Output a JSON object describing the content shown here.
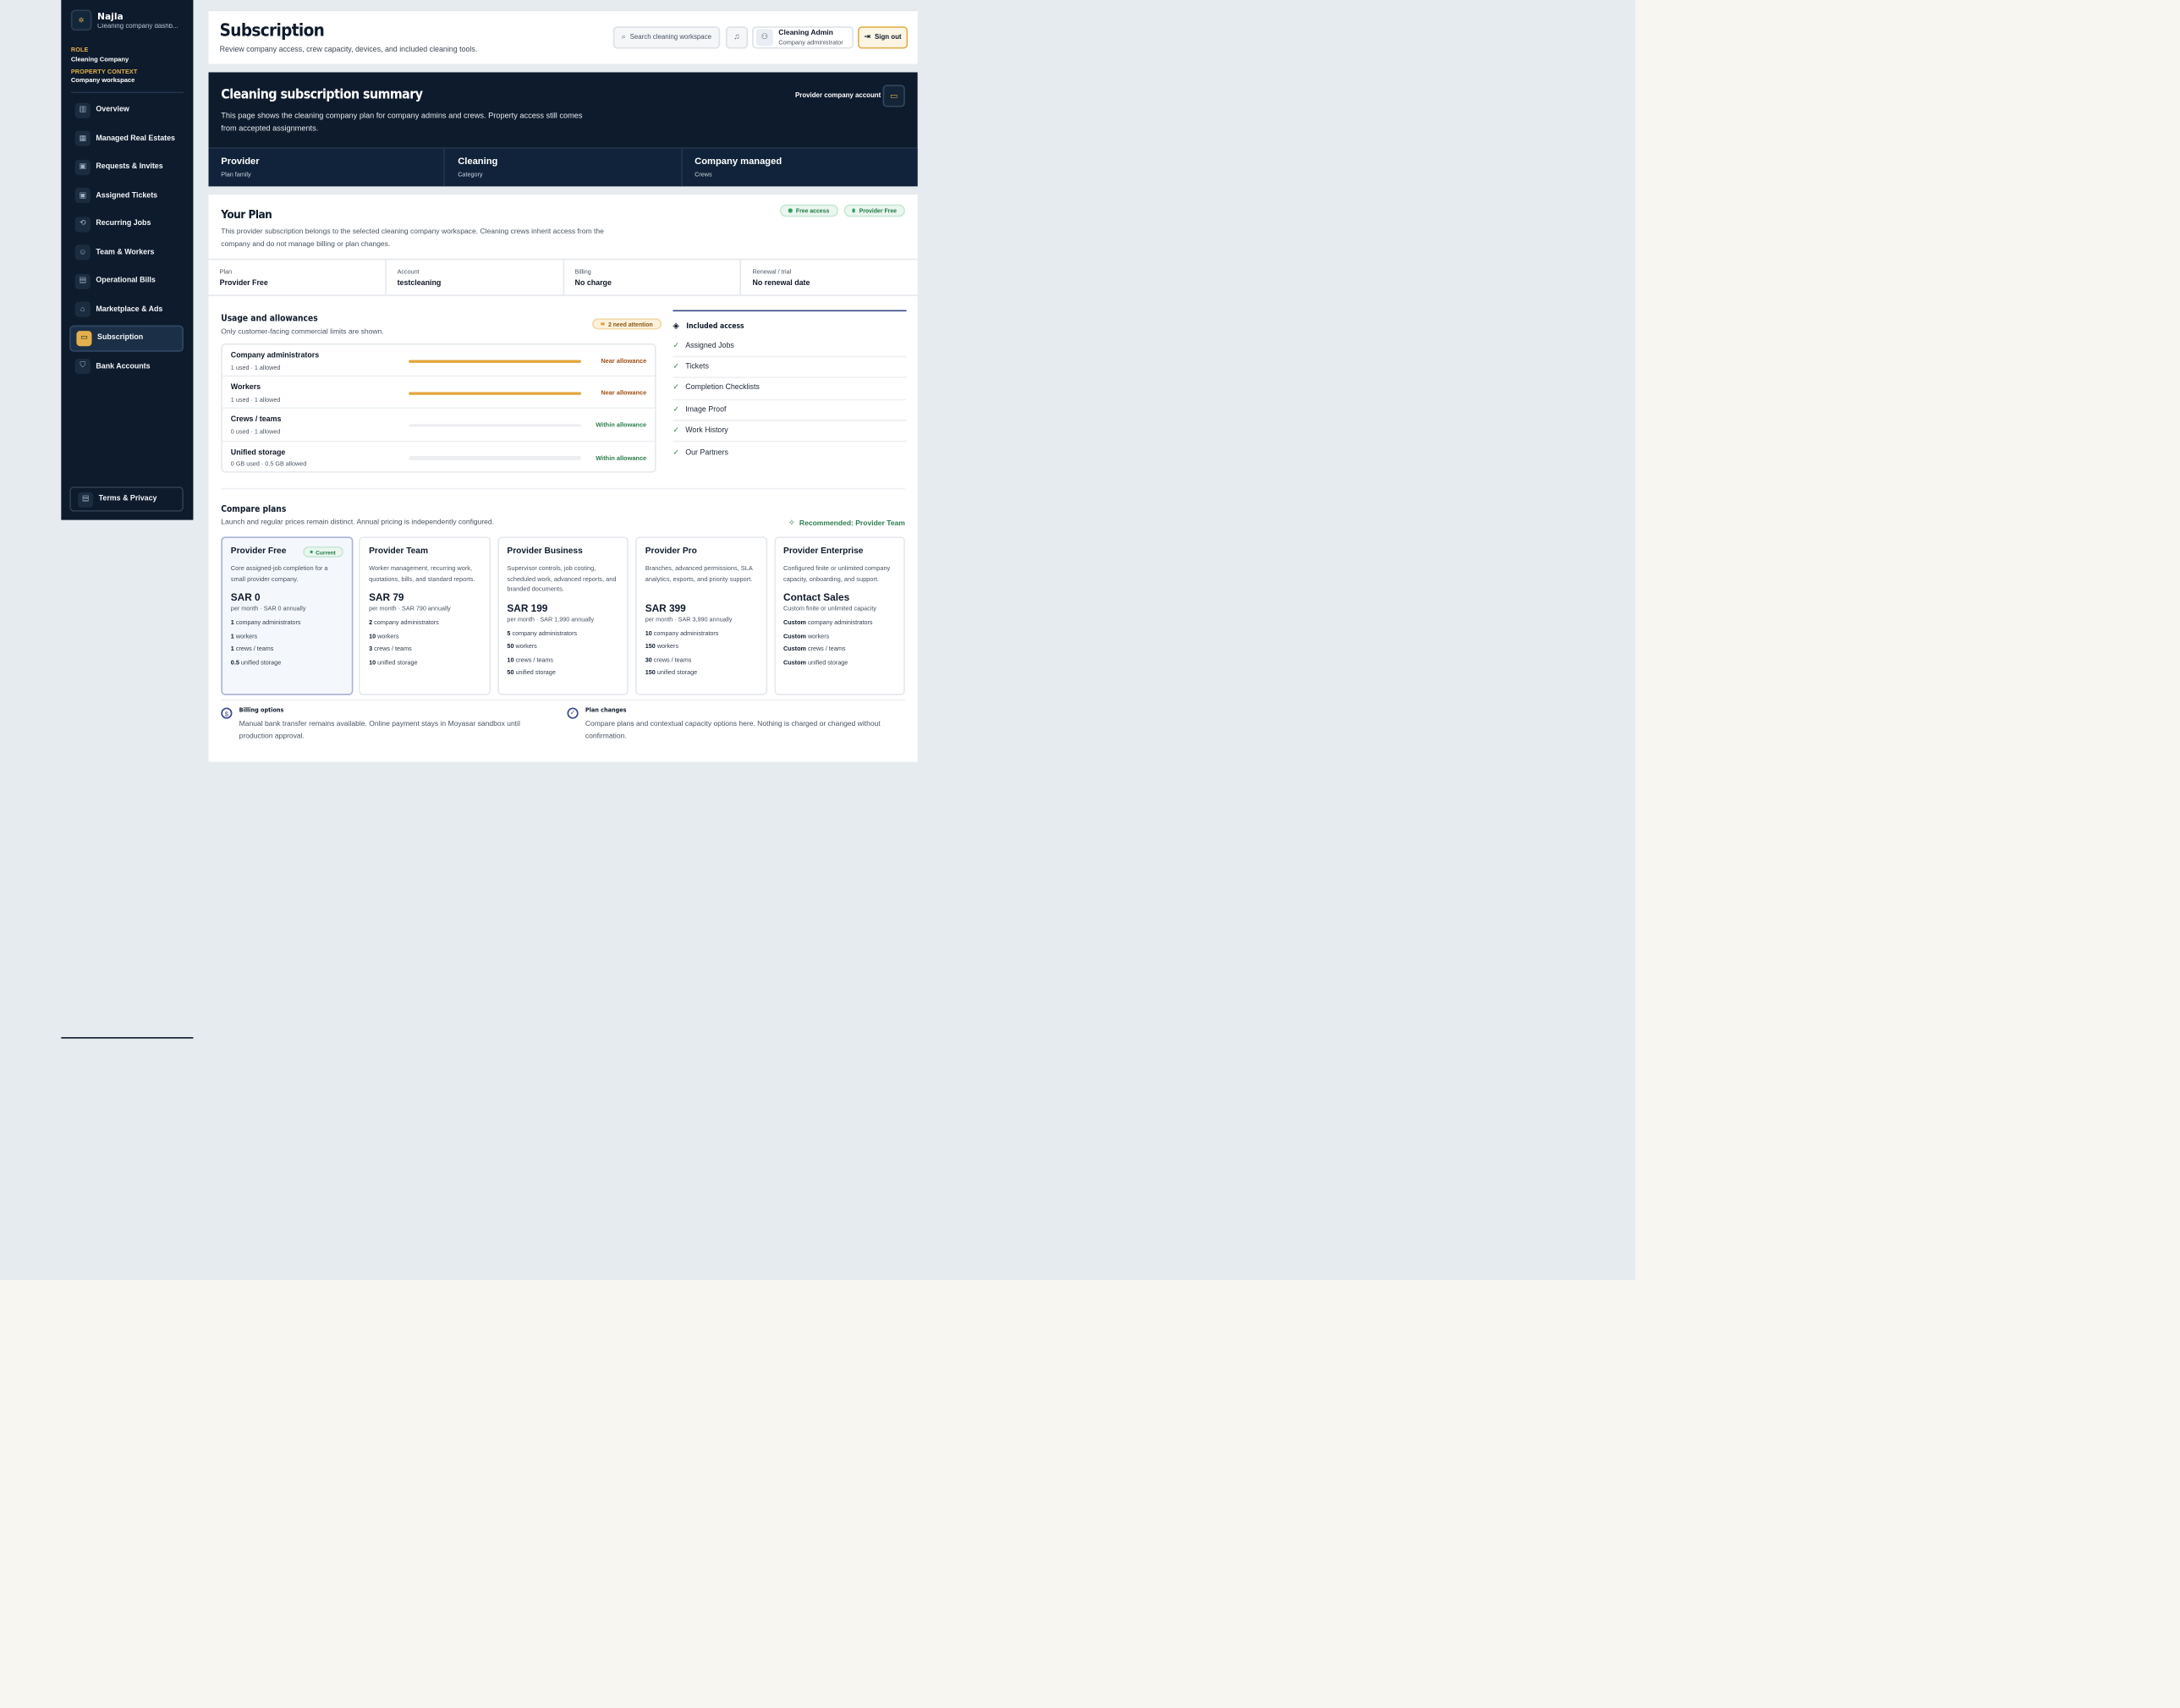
{
  "brand": {
    "name": "Najla",
    "subtitle": "Cleaning company dashb..."
  },
  "context": {
    "role_label": "ROLE",
    "role_value": "Cleaning Company",
    "property_label": "PROPERTY CONTEXT",
    "property_value": "Company workspace"
  },
  "nav": {
    "items": [
      {
        "label": "Overview",
        "icon": "chart-icon"
      },
      {
        "label": "Managed Real Estates",
        "icon": "building-icon"
      },
      {
        "label": "Requests & Invites",
        "icon": "clipboard-icon"
      },
      {
        "label": "Assigned Tickets",
        "icon": "clipboard-icon"
      },
      {
        "label": "Recurring Jobs",
        "icon": "repeat-icon"
      },
      {
        "label": "Team & Workers",
        "icon": "users-icon"
      },
      {
        "label": "Operational Bills",
        "icon": "receipt-icon"
      },
      {
        "label": "Marketplace & Ads",
        "icon": "store-icon"
      },
      {
        "label": "Subscription",
        "icon": "card-icon",
        "active": true
      },
      {
        "label": "Bank Accounts",
        "icon": "shield-icon"
      }
    ],
    "terms": "Terms & Privacy"
  },
  "header": {
    "title": "Subscription",
    "subtitle": "Review company access, crew capacity, devices, and included cleaning tools.",
    "search_placeholder": "Search cleaning workspace",
    "user_name": "Cleaning Admin",
    "user_role": "Company administrator",
    "signout": "Sign out"
  },
  "summary": {
    "title": "Cleaning subscription summary",
    "description": "This page shows the cleaning company plan for company admins and crews. Property access still comes from accepted assignments.",
    "account_label": "Provider company account",
    "stats": [
      {
        "value": "Provider",
        "label": "Plan family"
      },
      {
        "value": "Cleaning",
        "label": "Category"
      },
      {
        "value": "Company managed",
        "label": "Crews"
      }
    ]
  },
  "plan": {
    "title": "Your Plan",
    "description": "This provider subscription belongs to the selected cleaning company workspace. Cleaning crews inherit access from the company and do not manage billing or plan changes.",
    "badges": [
      "Free access",
      "Provider Free"
    ],
    "meta": [
      {
        "label": "Plan",
        "value": "Provider Free"
      },
      {
        "label": "Account",
        "value": "testcleaning"
      },
      {
        "label": "Billing",
        "value": "No charge"
      },
      {
        "label": "Renewal / trial",
        "value": "No renewal date"
      }
    ]
  },
  "usage": {
    "title": "Usage and allowances",
    "subtitle": "Only customer-facing commercial limits are shown.",
    "attention": "2 need attention",
    "rows": [
      {
        "name": "Company administrators",
        "detail": "1 used · 1 allowed",
        "status": "Near allowance",
        "fill": 1.0
      },
      {
        "name": "Workers",
        "detail": "1 used · 1 allowed",
        "status": "Near allowance",
        "fill": 1.0
      },
      {
        "name": "Crews / teams",
        "detail": "0 used · 1 allowed",
        "status": "Within allowance",
        "fill": 0.0
      },
      {
        "name": "Unified storage",
        "detail": "0 GB used · 0.5 GB allowed",
        "status": "Within allowance",
        "fill": 0.0
      }
    ]
  },
  "included": {
    "title": "Included access",
    "items": [
      "Assigned Jobs",
      "Tickets",
      "Completion Checklists",
      "Image Proof",
      "Work History",
      "Our Partners"
    ]
  },
  "compare": {
    "title": "Compare plans",
    "subtitle": "Launch and regular prices remain distinct. Annual pricing is independently configured.",
    "recommended": "Recommended: Provider Team",
    "current_label": "Current",
    "plans": [
      {
        "name": "Provider Free",
        "desc": "Core assigned-job completion for a small provider company.",
        "price": "SAR 0",
        "period": "per month · SAR 0 annually",
        "feats": [
          {
            "n": "1",
            "t": "company administrators"
          },
          {
            "n": "1",
            "t": "workers"
          },
          {
            "n": "1",
            "t": "crews / teams"
          },
          {
            "n": "0.5",
            "t": "unified storage"
          }
        ]
      },
      {
        "name": "Provider Team",
        "desc": "Worker management, recurring work, quotations, bills, and standard reports.",
        "price": "SAR 79",
        "period": "per month · SAR 790 annually",
        "feats": [
          {
            "n": "2",
            "t": "company administrators"
          },
          {
            "n": "10",
            "t": "workers"
          },
          {
            "n": "3",
            "t": "crews / teams"
          },
          {
            "n": "10",
            "t": "unified storage"
          }
        ]
      },
      {
        "name": "Provider Business",
        "desc": "Supervisor controls, job costing, scheduled work, advanced reports, and branded documents.",
        "price": "SAR 199",
        "period": "per month · SAR 1,990 annually",
        "feats": [
          {
            "n": "5",
            "t": "company administrators"
          },
          {
            "n": "50",
            "t": "workers"
          },
          {
            "n": "10",
            "t": "crews / teams"
          },
          {
            "n": "50",
            "t": "unified storage"
          }
        ]
      },
      {
        "name": "Provider Pro",
        "desc": "Branches, advanced permissions, SLA analytics, exports, and priority support.",
        "price": "SAR 399",
        "period": "per month · SAR 3,990 annually",
        "feats": [
          {
            "n": "10",
            "t": "company administrators"
          },
          {
            "n": "150",
            "t": "workers"
          },
          {
            "n": "30",
            "t": "crews / teams"
          },
          {
            "n": "150",
            "t": "unified storage"
          }
        ]
      },
      {
        "name": "Provider Enterprise",
        "desc": "Configured finite or unlimited company capacity, onboarding, and support.",
        "price": "Contact Sales",
        "period": "Custom finite or unlimited capacity",
        "feats": [
          {
            "n": "Custom",
            "t": "company administrators"
          },
          {
            "n": "Custom",
            "t": "workers"
          },
          {
            "n": "Custom",
            "t": "crews / teams"
          },
          {
            "n": "Custom",
            "t": "unified storage"
          }
        ]
      }
    ]
  },
  "footer": {
    "billing_title": "Billing options",
    "billing_desc": "Manual bank transfer remains available. Online payment stays in Moyasar sandbox until production approval.",
    "changes_title": "Plan changes",
    "changes_desc": "Compare plans and contextual capacity options here. Nothing is charged or changed without confirmation."
  },
  "colors": {
    "sidebar": "#0e1b2c",
    "accent": "#e3b04b",
    "success": "#2e7d4f",
    "warning": "#a04f16"
  }
}
